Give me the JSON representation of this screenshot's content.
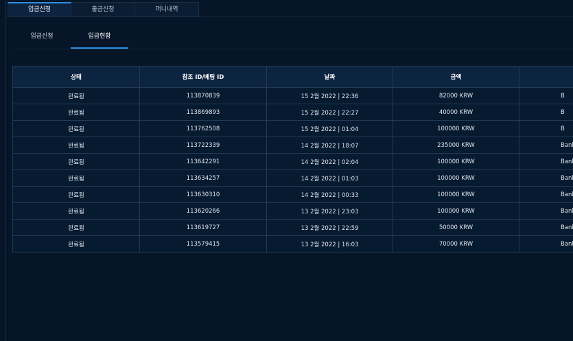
{
  "top_tabs": [
    {
      "label": "입금신청",
      "active": true
    },
    {
      "label": "출금신청",
      "active": false
    },
    {
      "label": "머니내역",
      "active": false
    }
  ],
  "sub_tabs": [
    {
      "label": "입금신청",
      "active": false
    },
    {
      "label": "입금현황",
      "active": true
    }
  ],
  "table": {
    "headers": [
      "상태",
      "참조 ID/베팅 ID",
      "날짜",
      "금액",
      ""
    ],
    "rows": [
      {
        "status": "완료됨",
        "ref_id": "113870839",
        "date": "15 2월 2022 | 22:36",
        "amount": "82000 KRW",
        "method": "B"
      },
      {
        "status": "완료됨",
        "ref_id": "113869893",
        "date": "15 2월 2022 | 22:27",
        "amount": "40000 KRW",
        "method": "B"
      },
      {
        "status": "완료됨",
        "ref_id": "113762508",
        "date": "15 2월 2022 | 01:04",
        "amount": "100000 KRW",
        "method": "B"
      },
      {
        "status": "완료됨",
        "ref_id": "113722339",
        "date": "14 2월 2022 | 18:07",
        "amount": "235000 KRW",
        "method": "BankT"
      },
      {
        "status": "완료됨",
        "ref_id": "113642291",
        "date": "14 2월 2022 | 02:04",
        "amount": "100000 KRW",
        "method": "BankT"
      },
      {
        "status": "완료됨",
        "ref_id": "113634257",
        "date": "14 2월 2022 | 01:03",
        "amount": "100000 KRW",
        "method": "BankT"
      },
      {
        "status": "완료됨",
        "ref_id": "113630310",
        "date": "14 2월 2022 | 00:33",
        "amount": "100000 KRW",
        "method": "BankT"
      },
      {
        "status": "완료됨",
        "ref_id": "113620266",
        "date": "13 2월 2022 | 23:03",
        "amount": "100000 KRW",
        "method": "BankT"
      },
      {
        "status": "완료됨",
        "ref_id": "113619727",
        "date": "13 2월 2022 | 22:59",
        "amount": "50000 KRW",
        "method": "BankT"
      },
      {
        "status": "완료됨",
        "ref_id": "113579415",
        "date": "13 2월 2022 | 16:03",
        "amount": "70000 KRW",
        "method": "BankT"
      }
    ]
  },
  "colors": {
    "background": "#061628",
    "accent": "#2e8fe3",
    "header_bg": "#0c2440",
    "border": "#243a54"
  }
}
